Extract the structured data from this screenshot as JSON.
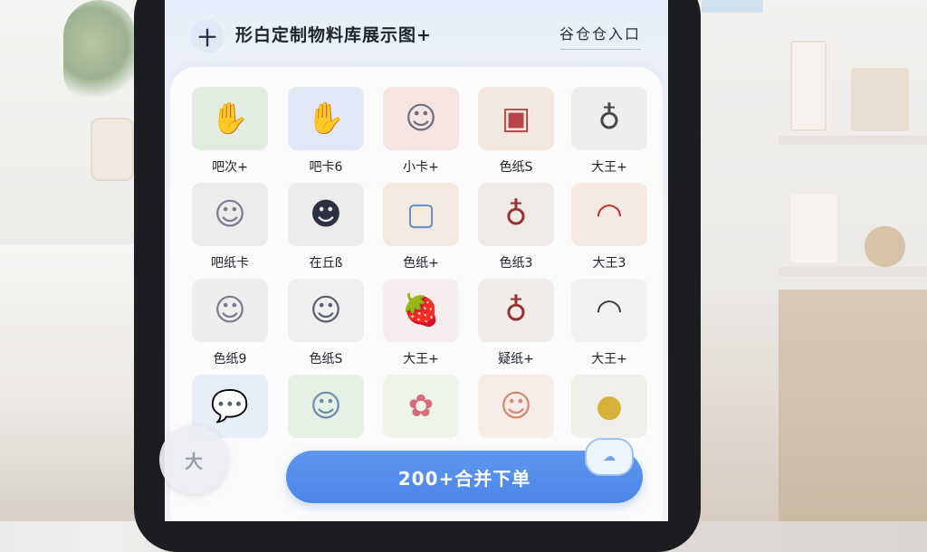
{
  "header": {
    "logo_glyph": "十",
    "title": "形白定制物料库展示图+",
    "entry_link": "谷仓仓入口"
  },
  "items": [
    {
      "label": "吧次+",
      "icon": "dark-hand-badge-icon",
      "glyph": "✋",
      "bg": "#e3ece0",
      "fg": "#2d3445"
    },
    {
      "label": "吧卡6",
      "icon": "dark-hand-badge-icon",
      "glyph": "✋",
      "bg": "#e2e8f6",
      "fg": "#2d3445"
    },
    {
      "label": "小卡+",
      "icon": "chibi-character-icon",
      "glyph": "☺",
      "bg": "#f5e4e2",
      "fg": "#6b6f80"
    },
    {
      "label": "色纸S",
      "icon": "color-paper-card-icon",
      "glyph": "▣",
      "bg": "#f3e7de",
      "fg": "#b5474a"
    },
    {
      "label": "大王+",
      "icon": "keychain-charm-icon",
      "glyph": "♁",
      "bg": "#eeeeef",
      "fg": "#4b4546"
    },
    {
      "label": "吧纸卡",
      "icon": "chibi-character-icon",
      "glyph": "☺",
      "bg": "#ececec",
      "fg": "#7a7d90"
    },
    {
      "label": "在丘ß",
      "icon": "chibi-character-icon",
      "glyph": "☻",
      "bg": "#ececec",
      "fg": "#2d3040"
    },
    {
      "label": "色纸+",
      "icon": "photo-card-icon",
      "glyph": "▢",
      "bg": "#f4e9de",
      "fg": "#5b8fc7"
    },
    {
      "label": "色纸3",
      "icon": "keychain-charm-icon",
      "glyph": "♁",
      "bg": "#eeeae8",
      "fg": "#9a3030"
    },
    {
      "label": "大王3",
      "icon": "folding-fan-icon",
      "glyph": "◠",
      "bg": "#f6e9e4",
      "fg": "#c0302c"
    },
    {
      "label": "色纸9",
      "icon": "chibi-character-icon",
      "glyph": "☺",
      "bg": "#eeeeee",
      "fg": "#7a7d90"
    },
    {
      "label": "色纸S",
      "icon": "chibi-character-icon",
      "glyph": "☺",
      "bg": "#efefef",
      "fg": "#5c6070"
    },
    {
      "label": "大王+",
      "icon": "strawberry-icon",
      "glyph": "🍓",
      "bg": "#f6eeee",
      "fg": "#c63a3a"
    },
    {
      "label": "疑纸+",
      "icon": "keychain-charm-icon",
      "glyph": "♁",
      "bg": "#f0ecea",
      "fg": "#9a3030"
    },
    {
      "label": "大王+",
      "icon": "folding-fan-icon",
      "glyph": "◠",
      "bg": "#f2f1f1",
      "fg": "#3a3a3a"
    },
    {
      "label": "",
      "icon": "speech-bubble-icon",
      "glyph": "💬",
      "bg": "#e7edf9",
      "fg": "#3b3f4a"
    },
    {
      "label": "",
      "icon": "chibi-character-icon",
      "glyph": "☺",
      "bg": "#e6efe4",
      "fg": "#6d90a8"
    },
    {
      "label": "",
      "icon": "flower-mascot-icon",
      "glyph": "✿",
      "bg": "#eef4ea",
      "fg": "#d86a7a"
    },
    {
      "label": "",
      "icon": "chibi-character-icon",
      "glyph": "☺",
      "bg": "#f8ece8",
      "fg": "#d9866b"
    },
    {
      "label": "",
      "icon": "gold-badge-icon",
      "glyph": "●",
      "bg": "#f1efe9",
      "fg": "#d7b23a"
    }
  ],
  "bottom": {
    "order_button": "200+合并下单",
    "side_fab_glyph": "大"
  },
  "colors": {
    "accent": "#4b86e6",
    "title_text": "#1f2330"
  }
}
